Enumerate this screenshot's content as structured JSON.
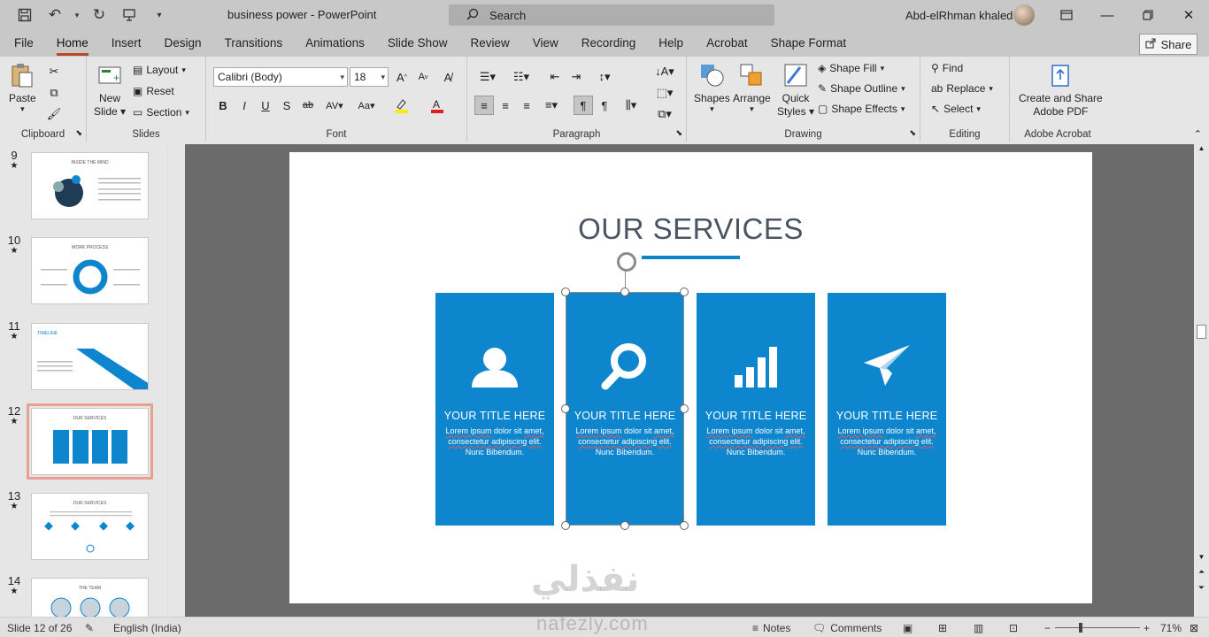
{
  "window": {
    "doc_title": "business power",
    "app_name": "PowerPoint",
    "search_placeholder": "Search",
    "user_name": "Abd-elRhman khaled"
  },
  "tabs": [
    "File",
    "Home",
    "Insert",
    "Design",
    "Transitions",
    "Animations",
    "Slide Show",
    "Review",
    "View",
    "Recording",
    "Help",
    "Acrobat",
    "Shape Format"
  ],
  "active_tab": "Home",
  "share_label": "Share",
  "ribbon": {
    "clipboard": {
      "label": "Clipboard",
      "paste": "Paste"
    },
    "slides": {
      "label": "Slides",
      "new_slide_1": "New",
      "new_slide_2": "Slide",
      "layout": "Layout",
      "reset": "Reset",
      "section": "Section"
    },
    "font": {
      "label": "Font",
      "font_name": "Calibri (Body)",
      "font_size": "18"
    },
    "paragraph": {
      "label": "Paragraph"
    },
    "drawing": {
      "label": "Drawing",
      "shapes": "Shapes",
      "arrange": "Arrange",
      "quick_styles_1": "Quick",
      "quick_styles_2": "Styles",
      "shape_fill": "Shape Fill",
      "shape_outline": "Shape Outline",
      "shape_effects": "Shape Effects"
    },
    "editing": {
      "label": "Editing",
      "find": "Find",
      "replace": "Replace",
      "select": "Select"
    },
    "acrobat": {
      "label": "Adobe Acrobat",
      "create_share_1": "Create and Share",
      "create_share_2": "Adobe PDF"
    }
  },
  "thumbnails": [
    {
      "num": "9",
      "caption": "INSIDE THE MIND"
    },
    {
      "num": "10",
      "caption": "WORK PROCESS"
    },
    {
      "num": "11",
      "caption": "TIMELINE"
    },
    {
      "num": "12",
      "caption": "OUR SERVICES"
    },
    {
      "num": "13",
      "caption": "OUR SERVICES"
    },
    {
      "num": "14",
      "caption": "THE TEAM"
    }
  ],
  "selected_slide": "12",
  "slide": {
    "title": "OUR SERVICES",
    "cards": [
      {
        "icon": "user-icon",
        "title": "YOUR TITLE HERE",
        "line1_a": "Lorem ipsum",
        "line1_b": " dolor sit ",
        "line1_c": "amet,",
        "line2": "consectetur adipiscing elit.",
        "line3": "Nunc Bibendum."
      },
      {
        "icon": "search-icon",
        "title": "YOUR TITLE HERE",
        "line1_a": "Lorem ipsum",
        "line1_b": " dolor sit ",
        "line1_c": "amet,",
        "line2": "consectetur adipiscing elit.",
        "line3": "Nunc Bibendum."
      },
      {
        "icon": "bar-chart-icon",
        "title": "YOUR TITLE HERE",
        "line1_a": "Lorem ipsum",
        "line1_b": " dolor sit ",
        "line1_c": "amet,",
        "line2": "consectetur adipiscing elit.",
        "line3": "Nunc Bibendum."
      },
      {
        "icon": "paper-plane-icon",
        "title": "YOUR TITLE HERE",
        "line1_a": "Lorem ipsum",
        "line1_b": " dolor sit ",
        "line1_c": "amet,",
        "line2": "consectetur adipiscing elit.",
        "line3": "Nunc Bibendum."
      }
    ],
    "accent_color": "#0d86cd"
  },
  "watermark": {
    "arabic": "نفذلي",
    "latin": "nafezly.com"
  },
  "status": {
    "slide_info": "Slide 12 of 26",
    "language": "English (India)",
    "notes": "Notes",
    "comments": "Comments",
    "zoom": "71%"
  }
}
